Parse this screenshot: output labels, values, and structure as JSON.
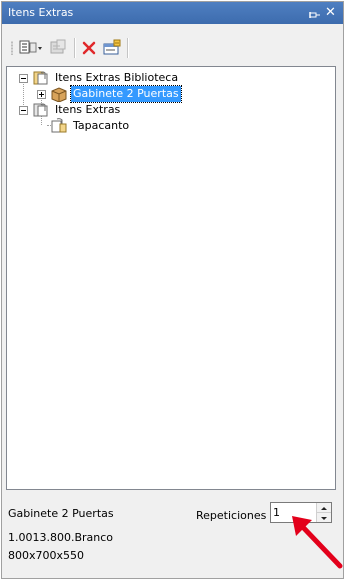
{
  "window": {
    "title": "Itens Extras"
  },
  "toolbar": {
    "buttons": [
      {
        "icon": "document-list-dropdown-icon"
      },
      {
        "icon": "properties-disabled-icon"
      },
      {
        "icon": "delete-x-icon",
        "color": "#e0282a"
      },
      {
        "icon": "edit-form-icon"
      }
    ]
  },
  "tree": {
    "root1": {
      "label": "Itens Extras Biblioteca",
      "icon": "library-binder-icon"
    },
    "root1_child": {
      "label": "Gabinete 2 Puertas",
      "icon": "cabinet-box-icon",
      "selected": true
    },
    "root2": {
      "label": "Itens Extras",
      "icon": "extras-binder-icon"
    },
    "root2_child": {
      "label": "Tapacanto",
      "icon": "edge-band-icon"
    }
  },
  "details": {
    "name": "Gabinete 2 Puertas",
    "code": "1.0013.800.Branco",
    "dimensions": "800x700x550"
  },
  "repetitions": {
    "label": "Repeticiones",
    "value": "1"
  },
  "annotation": {
    "color": "#e3001b"
  }
}
